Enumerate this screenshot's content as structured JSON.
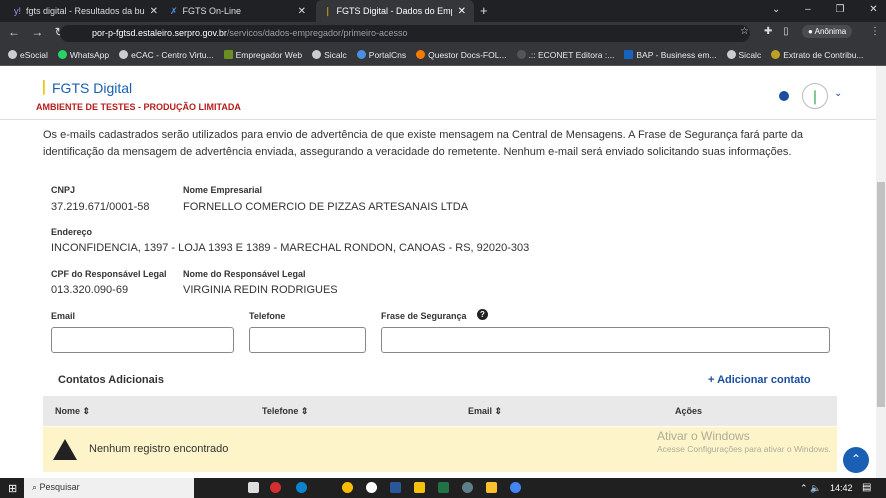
{
  "browser": {
    "tabs": [
      {
        "title": "fgts digital - Resultados da busca"
      },
      {
        "title": "FGTS On-Line"
      },
      {
        "title": "FGTS Digital - Dados do Empregador"
      }
    ],
    "url_host": "por-p-fgtsd.estaleiro.serpro.gov.br",
    "url_path": "/servicos/dados-empregador/primeiro-acesso",
    "profile": "Anônima",
    "bookmarks": [
      "eSocial",
      "WhatsApp",
      "eCAC - Centro Virtu...",
      "Empregador Web",
      "Sicalc",
      "PortalCns",
      "Questor Docs-FOL...",
      ".:: ECONET Editora :...",
      "BAP - Business em...",
      "Sicalc",
      "Extrato de Contribu..."
    ]
  },
  "header": {
    "brand": "FGTS Digital",
    "env": "AMBIENTE DE TESTES - PRODUÇÃO LIMITADA"
  },
  "intro": "Os e-mails cadastrados serão utilizados para envio de advertência de que existe mensagem na Central de Mensagens. A Frase de Segurança fará parte da identificação da mensagem de advertência enviada, assegurando a veracidade do remetente. Nenhum e-mail será enviado solicitando suas informações.",
  "fields": {
    "cnpj_label": "CNPJ",
    "cnpj": "37.219.671/0001-58",
    "nome_label": "Nome Empresarial",
    "nome": "FORNELLO COMERCIO DE PIZZAS ARTESANAIS LTDA",
    "end_label": "Endereço",
    "end": "INCONFIDENCIA, 1397 - LOJA 1393 E 1389 - MARECHAL RONDON, CANOAS - RS, 92020-303",
    "cpf_label": "CPF do Responsável Legal",
    "cpf": "013.320.090-69",
    "resp_label": "Nome do Responsável Legal",
    "resp": "VIRGINIA REDIN RODRIGUES"
  },
  "form": {
    "email_label": "Email",
    "tel_label": "Telefone",
    "frase_label": "Frase de Segurança",
    "email": "",
    "tel": "",
    "frase": ""
  },
  "contacts": {
    "title": "Contatos Adicionais",
    "add": "Adicionar contato",
    "columns": [
      "Nome",
      "Telefone",
      "Email",
      "Ações"
    ],
    "empty": "Nenhum registro encontrado"
  },
  "watermark": {
    "title": "Ativar o Windows",
    "sub": "Acesse Configurações para ativar o Windows."
  },
  "taskbar": {
    "search": "Pesquisar",
    "time": "14:42"
  }
}
